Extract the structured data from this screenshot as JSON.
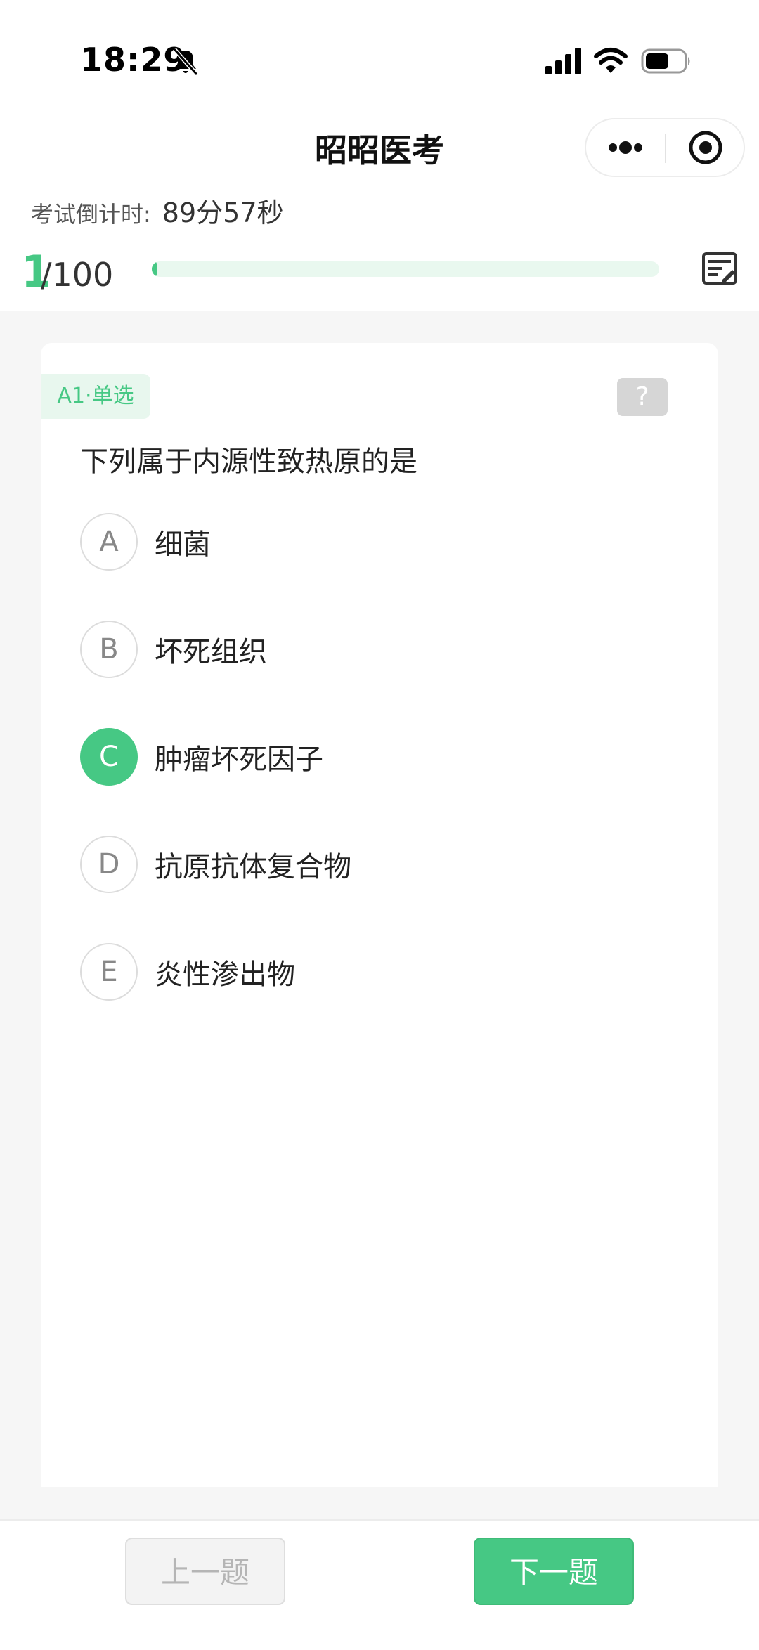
{
  "status_bar": {
    "time": "18:29",
    "icons": [
      "bell-muted-icon",
      "signal-icon",
      "wifi-icon",
      "battery-icon"
    ]
  },
  "nav": {
    "title": "昭昭医考",
    "icons": [
      "more-icon",
      "close-target-icon"
    ]
  },
  "timer": {
    "label": "考试倒计时:",
    "value": "89分57秒"
  },
  "progress": {
    "current": "1",
    "total": "/100",
    "fraction": 0.01
  },
  "question": {
    "type_tag": "A1·单选",
    "help_label": "?",
    "text": "下列属于内源性致热原的是",
    "options": [
      {
        "letter": "A",
        "text": "细菌",
        "selected": false
      },
      {
        "letter": "B",
        "text": "坏死组织",
        "selected": false
      },
      {
        "letter": "C",
        "text": "肿瘤坏死因子",
        "selected": true
      },
      {
        "letter": "D",
        "text": "抗原抗体复合物",
        "selected": false
      },
      {
        "letter": "E",
        "text": "炎性渗出物",
        "selected": false
      }
    ]
  },
  "footer": {
    "prev_label": "上一题",
    "next_label": "下一题"
  },
  "colors": {
    "accent": "#46c884",
    "accent_light": "#e8f7ee"
  }
}
